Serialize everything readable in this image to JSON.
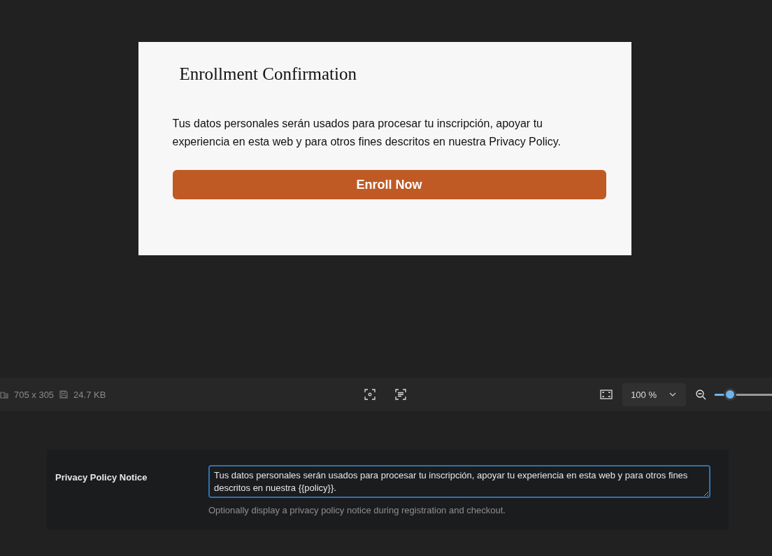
{
  "preview": {
    "title": "Enrollment Confirmation",
    "notice": "Tus datos personales serán usados para procesar tu inscripción, apoyar tu experiencia en esta web y para otros fines descritos en nuestra Privacy Policy.",
    "button": "Enroll Now"
  },
  "toolbar": {
    "dimensions": "705 x 305",
    "file_size": "24.7 KB",
    "zoom": "100 %",
    "zoom_slider": {
      "level": 0.27
    }
  },
  "setting": {
    "label": "Privacy Policy Notice",
    "value": "Tus datos personales serán usados para procesar tu inscripción, apoyar tu experiencia en esta web y para otros fines descritos en nuestra {{policy}}.",
    "help": "Optionally display a privacy policy notice during registration and checkout."
  }
}
